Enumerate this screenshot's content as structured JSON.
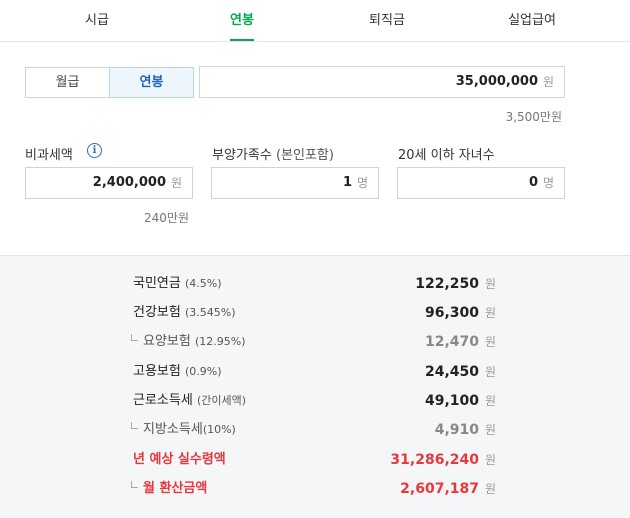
{
  "tabs": [
    {
      "label": "시급"
    },
    {
      "label": "연봉",
      "active": true
    },
    {
      "label": "퇴직금"
    },
    {
      "label": "실업급여"
    }
  ],
  "pay_type": {
    "monthly": "월급",
    "annual": "연봉",
    "selected": "연봉"
  },
  "salary": {
    "value": "35,000,000",
    "unit": "원",
    "hint": "3,500만원"
  },
  "nontax": {
    "label": "비과세액",
    "info_icon": "info-icon",
    "value": "2,400,000",
    "unit": "원",
    "hint": "240만원"
  },
  "dependents": {
    "label": "부양가족수",
    "label_paren": "(본인포함)",
    "value": "1",
    "unit": "명"
  },
  "children": {
    "label": "20세 이하 자녀수",
    "value": "0",
    "unit": "명"
  },
  "results": [
    {
      "name": "국민연금",
      "rate": "(4.5%)",
      "amount": "122,250",
      "unit": "원"
    },
    {
      "name": "건강보험",
      "rate": "(3.545%)",
      "amount": "96,300",
      "unit": "원"
    },
    {
      "name": "요양보험",
      "rate": "(12.95%)",
      "amount": "12,470",
      "unit": "원",
      "sub": true
    },
    {
      "name": "고용보험",
      "rate": "(0.9%)",
      "amount": "24,450",
      "unit": "원"
    },
    {
      "name": "근로소득세",
      "rate": "(간이세액)",
      "amount": "49,100",
      "unit": "원"
    },
    {
      "name": "지방소득세",
      "rate": "(10%)",
      "amount": "4,910",
      "unit": "원",
      "sub": true
    },
    {
      "name": "년 예상 실수령액",
      "rate": "",
      "amount": "31,286,240",
      "unit": "원",
      "highlight": true
    },
    {
      "name": "월 환산금액",
      "rate": "",
      "amount": "2,607,187",
      "unit": "원",
      "highlight": true,
      "sub": true
    }
  ],
  "colors": {
    "accent_green": "#03a94f",
    "selected_blue": "#2264b6",
    "highlight_red": "#e8383d"
  }
}
